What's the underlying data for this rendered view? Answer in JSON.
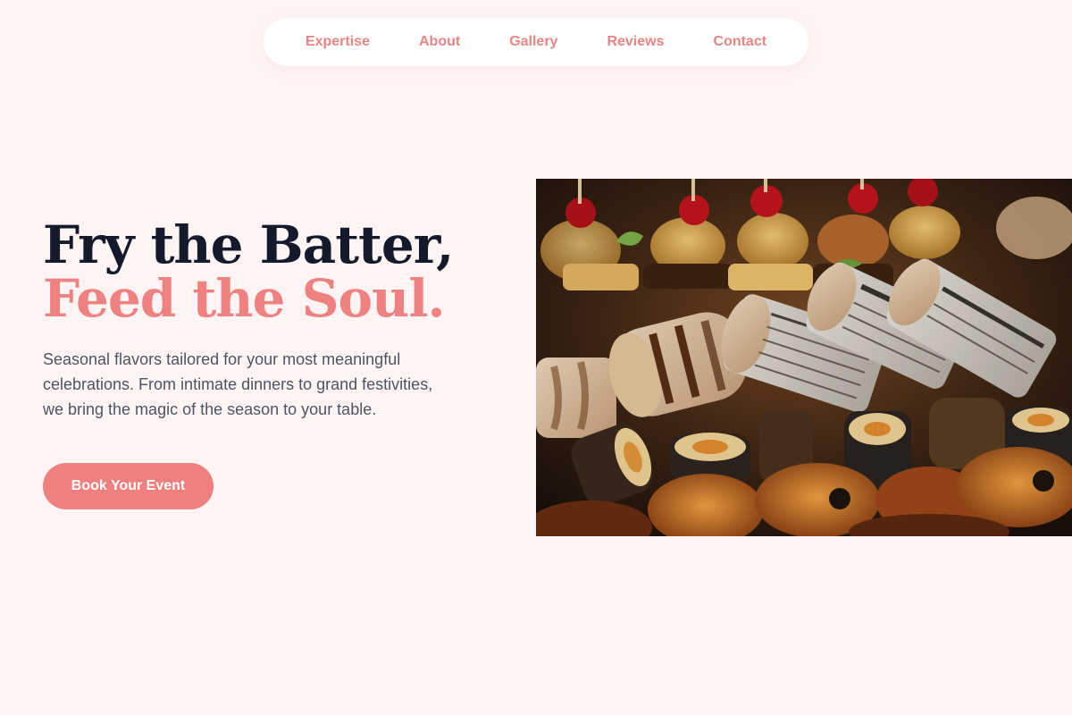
{
  "nav": {
    "items": [
      {
        "label": "Expertise"
      },
      {
        "label": "About"
      },
      {
        "label": "Gallery"
      },
      {
        "label": "Reviews"
      },
      {
        "label": "Contact"
      }
    ]
  },
  "hero": {
    "title_line1": "Fry the Batter,",
    "title_line2": "Feed the Soul.",
    "description": "Seasonal flavors tailored for your most meaningful celebrations. From intimate dinners to grand festivities, we bring the magic of the season to your table.",
    "cta_label": "Book Your Event"
  },
  "colors": {
    "background": "#fff4f4",
    "accent": "#f08080",
    "heading": "#131a2c",
    "body_text": "#4c5565"
  },
  "icons": {
    "hero_image": "food-platter-image"
  }
}
